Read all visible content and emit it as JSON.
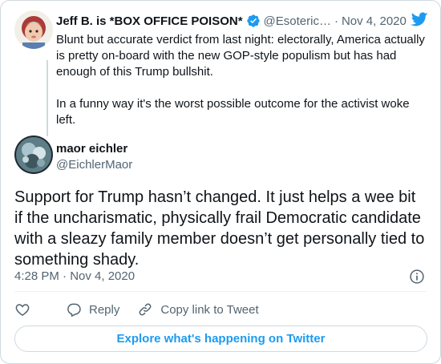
{
  "parent_tweet": {
    "display_name": "Jeff B. is *BOX OFFICE POISON*",
    "handle": "@Esoteric…",
    "separator": "·",
    "date": "Nov 4, 2020",
    "text": "Blunt but accurate verdict from last night: electorally, America actually is pretty on-board with the new GOP-style populism but has had enough of this Trump bullshit.\n\nIn a funny way it's the worst possible outcome for the activist woke left.",
    "verified": true
  },
  "tweet": {
    "display_name": "maor eichler",
    "handle": "@EichlerMaor",
    "text": "Support for Trump hasn’t changed. It just helps a wee bit if the uncharismatic, physically frail Democratic candidate with a sleazy family member doesn’t get personally tied to something shady.",
    "timestamp": "4:28 PM · Nov 4, 2020"
  },
  "actions": {
    "reply_label": "Reply",
    "copy_link_label": "Copy link to Tweet"
  },
  "explore_label": "Explore what's happening on Twitter",
  "icons": {
    "brand": "twitter-bird-icon",
    "verified": "verified-badge-icon",
    "like": "heart-icon",
    "reply": "speech-bubble-icon",
    "copy_link": "link-icon",
    "info": "info-icon"
  },
  "colors": {
    "accent": "#1d9bf0",
    "text": "#0f1419",
    "secondary_text": "#536471",
    "border": "#cfd9de"
  }
}
